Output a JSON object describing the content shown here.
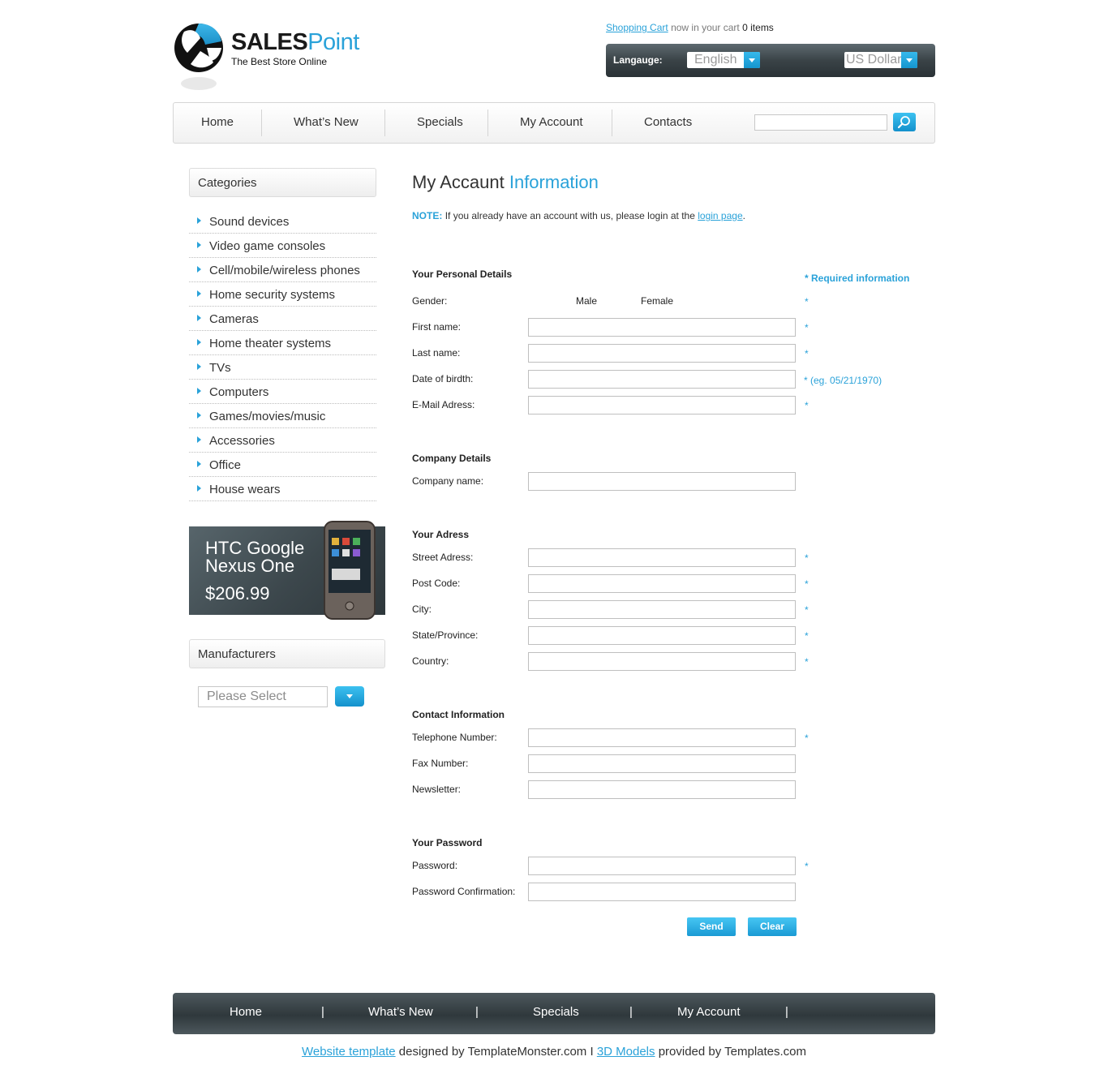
{
  "brand": {
    "name_part1": "SALES",
    "name_part2": "Point",
    "tagline": "The Best Store Online"
  },
  "cart": {
    "link": "Shopping Cart",
    "text": "now in your cart",
    "count": "0",
    "unit": "items"
  },
  "prefs": {
    "language_label": "Langauge:",
    "language_value": "English",
    "currency_value": "US Dollar"
  },
  "topnav": {
    "items": [
      "Home",
      "What’s New",
      "Specials",
      "My Account",
      "Contacts"
    ],
    "search_value": ""
  },
  "sidebar": {
    "categories_title": "Categories",
    "categories": [
      "Sound devices",
      "Video game consoles",
      "Cell/mobile/wireless phones",
      "Home security systems",
      "Cameras",
      "Home theater systems",
      "TVs",
      "Computers",
      "Games/movies/music",
      "Accessories",
      "Office",
      "House wears"
    ],
    "promo": {
      "name": "HTC Google Nexus One",
      "price": "$206.99"
    },
    "manufacturers_title": "Manufacturers",
    "manufacturers_placeholder": "Please Select"
  },
  "main": {
    "title_part1": "My Accaunt",
    "title_part2": "Information",
    "note_label": "NOTE:",
    "note_text": "If you already have an account with us, please login at the",
    "note_link": "login page",
    "note_end": ".",
    "required_info": "* Required information",
    "personal": {
      "heading": "Your Personal Details",
      "gender_label": "Gender:",
      "gender_male": "Male",
      "gender_female": "Female",
      "first_name": "First name:",
      "last_name": "Last name:",
      "dob": "Date of birdth:",
      "dob_hint": "* (eg. 05/21/1970)",
      "email": "E-Mail Adress:"
    },
    "company": {
      "heading": "Company Details",
      "name": "Company name:"
    },
    "address": {
      "heading": "Your Adress",
      "street": "Street Adress:",
      "post_code": "Post Code:",
      "city": "City:",
      "state": "State/Province:",
      "country": "Country:"
    },
    "contact": {
      "heading": "Contact Information",
      "telephone": "Telephone Number:",
      "fax": "Fax Number:",
      "newsletter": "Newsletter:"
    },
    "password": {
      "heading": "Your Password",
      "password": "Password:",
      "confirmation": "Password Confirmation:"
    },
    "star": "*",
    "buttons": {
      "send": "Send",
      "clear": "Clear"
    }
  },
  "footnav": {
    "items": [
      "Home",
      "What’s New",
      "Specials",
      "My Account"
    ],
    "separator": "|"
  },
  "credits": {
    "link1": "Website template",
    "text1": "designed by TemplateMonster.com I",
    "link2": "3D Models",
    "text2": "provided by Templates.com"
  },
  "colors": {
    "accent": "#2aa2d9",
    "dark_bar": "#3a4347"
  }
}
